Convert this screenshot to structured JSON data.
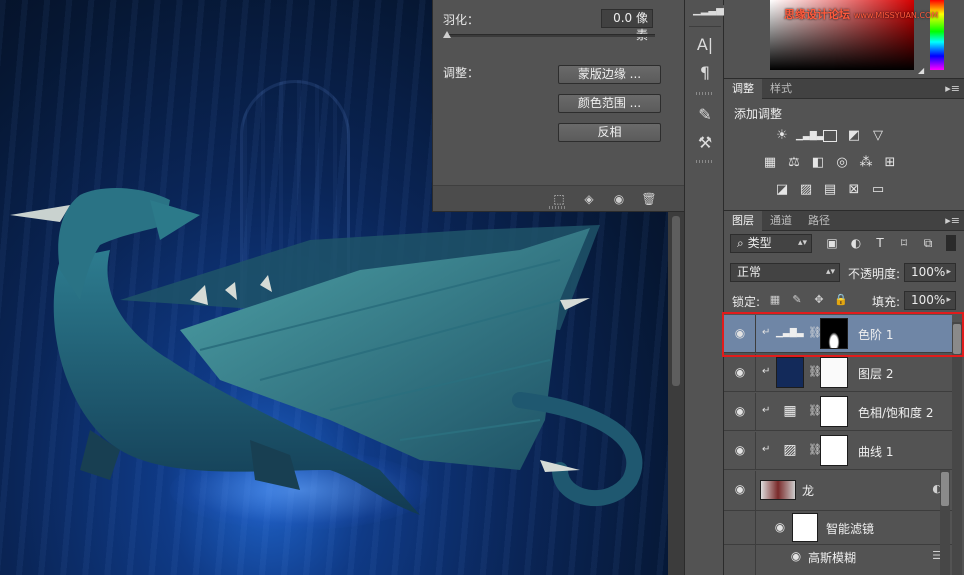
{
  "properties": {
    "feather_label": "羽化：",
    "feather_value": "0.0 像素",
    "feather_slider_level": 0,
    "refine_label": "调整：",
    "btn_mask_edge": "蒙版边缘 ...",
    "btn_color_range": "颜色范围 ...",
    "btn_invert": "反相",
    "footer_icons": [
      "selection-from-mask-icon",
      "apply-mask-icon",
      "visibility-eye-icon",
      "delete-mask-icon"
    ]
  },
  "toolstrip": {
    "icons": [
      "histogram-icon",
      "character-icon",
      "paragraph-icon",
      "brush-presets-icon",
      "tool-presets-icon"
    ],
    "character_glyph": "A|",
    "paragraph_glyph": "¶"
  },
  "watermark": {
    "text_cn": "思缘设计论坛",
    "text_url": "www.MISSYUAN.COM"
  },
  "colors": {
    "canvas_dark": "#061733",
    "panel_bg": "#535353",
    "selected_layer": "#6f86a6",
    "highlight_box": "#e21b1b",
    "watermark": "#ff5a3c"
  },
  "adjustments": {
    "tabs": [
      "调整",
      "样式"
    ],
    "title": "添加调整",
    "icons_row1": [
      "brightness-contrast-icon",
      "levels-icon",
      "curves-icon",
      "exposure-icon",
      "vibrance-icon"
    ],
    "icons_row2": [
      "hue-saturation-icon",
      "color-balance-icon",
      "black-white-icon",
      "photo-filter-icon",
      "channel-mixer-icon",
      "color-lookup-icon"
    ],
    "icons_row3": [
      "invert-icon",
      "posterize-icon",
      "threshold-icon",
      "selective-color-icon",
      "gradient-map-icon"
    ]
  },
  "layers_panel": {
    "tabs": [
      "图层",
      "通道",
      "路径"
    ],
    "filter_kind": "类型",
    "blend_mode": "正常",
    "opacity_label": "不透明度:",
    "opacity_value": "100%",
    "lock_label": "锁定:",
    "fill_label": "填充:",
    "fill_value": "100%",
    "layers": [
      {
        "name": "色阶 1",
        "kind": "adjustment-levels",
        "clipped": true,
        "selected": true
      },
      {
        "name": "图层 2",
        "kind": "pixel",
        "clipped": true,
        "selected": false
      },
      {
        "name": "色相/饱和度 2",
        "kind": "adjustment-hue",
        "clipped": true,
        "selected": false
      },
      {
        "name": "曲线 1",
        "kind": "adjustment-curves",
        "clipped": true,
        "selected": false
      },
      {
        "name": "龙",
        "kind": "smart-object",
        "clipped": false,
        "selected": false
      }
    ],
    "smart_filters_label": "智能滤镜",
    "filter_gaussian": "高斯模糊"
  }
}
